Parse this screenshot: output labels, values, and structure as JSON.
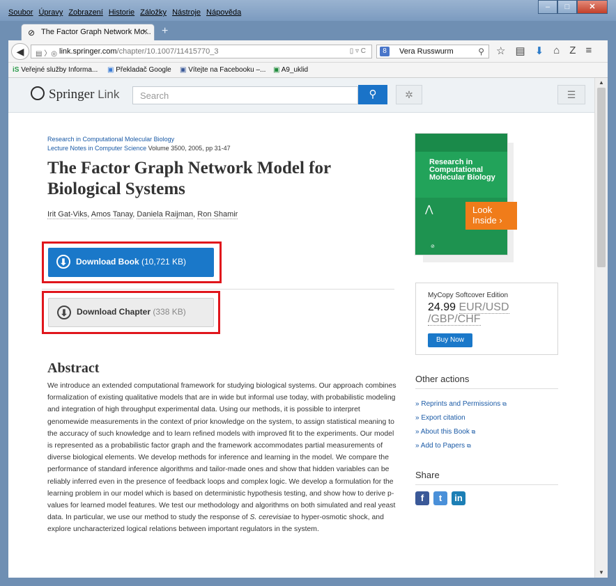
{
  "menu": {
    "items": [
      "Soubor",
      "Úpravy",
      "Zobrazení",
      "Historie",
      "Záložky",
      "Nástroje",
      "Nápověda"
    ]
  },
  "tab": {
    "title": "The Factor Graph Network Mo..."
  },
  "navbar": {
    "url_host": "link.springer.com",
    "url_path": "/chapter/10.1007/11415770_3",
    "search_value": "Vera Russwurm"
  },
  "bookmarks": [
    "Veřejné služby Informa...",
    "Překladač Google",
    "Vítejte na Facebooku –...",
    "A9_uklid"
  ],
  "springer": {
    "logo_text": "Springer",
    "logo_link": "Link",
    "search_placeholder": "Search"
  },
  "article": {
    "series_name": "Research in Computational Molecular Biology",
    "lncs": "Lecture Notes in Computer Science",
    "volume_info": "Volume 3500, 2005, pp 31-47",
    "title": "The Factor Graph Network Model for Biological Systems",
    "authors": [
      "Irit Gat-Viks",
      "Amos Tanay",
      "Daniela Raijman",
      "Ron Shamir"
    ],
    "download_book_label": "Download Book",
    "download_book_size": "(10,721 KB)",
    "download_chapter_label": "Download Chapter",
    "download_chapter_size": "(338 KB)",
    "abstract_heading": "Abstract",
    "abstract_text_before": "We introduce an extended computational framework for studying biological systems. Our approach combines formalization of existing qualitative models that are in wide but informal use today, with probabilistic modeling and integration of high throughput experimental data. Using our methods, it is possible to interpret genomewide measurements in the context of prior knowledge on the system, to assign statistical meaning to the accuracy of such knowledge and to learn refined models with improved fit to the experiments. Our model is represented as a probabilistic factor graph and the framework accommodates partial measurements of diverse biological elements. We develop methods for inference and learning in the model. We compare the performance of standard inference algorithms and tailor-made ones and show that hidden variables can be reliably inferred even in the presence of feedback loops and complex logic. We develop a formulation for the learning problem in our model which is based on deterministic hypothesis testing, and show how to derive p-values for learned model features. We test our methodology and algorithms on both simulated and real yeast data. In particular, we use our method to study the response of ",
    "abstract_italic": "S. cerevisiae",
    "abstract_text_after": " to hyper-osmotic shock, and explore uncharacterized logical relations between important regulators in the system."
  },
  "cover": {
    "title": "Research in Computational Molecular Biology",
    "look_inside": "Look Inside"
  },
  "mycopy": {
    "title": "MyCopy Softcover Edition",
    "price": "24.99",
    "currency": "EUR/USD /GBP/CHF",
    "buy_label": "Buy Now"
  },
  "other_actions": {
    "heading": "Other actions",
    "items": [
      "Reprints and Permissions",
      "Export citation",
      "About this Book",
      "Add to Papers"
    ]
  },
  "share": {
    "heading": "Share",
    "icons": [
      "facebook-icon",
      "twitter-icon",
      "linkedin-icon"
    ]
  },
  "colors": {
    "springer_blue": "#1a78c9",
    "highlight_red": "#e0161c",
    "cover_green": "#22a35a",
    "look_inside_orange": "#f07c1a"
  }
}
